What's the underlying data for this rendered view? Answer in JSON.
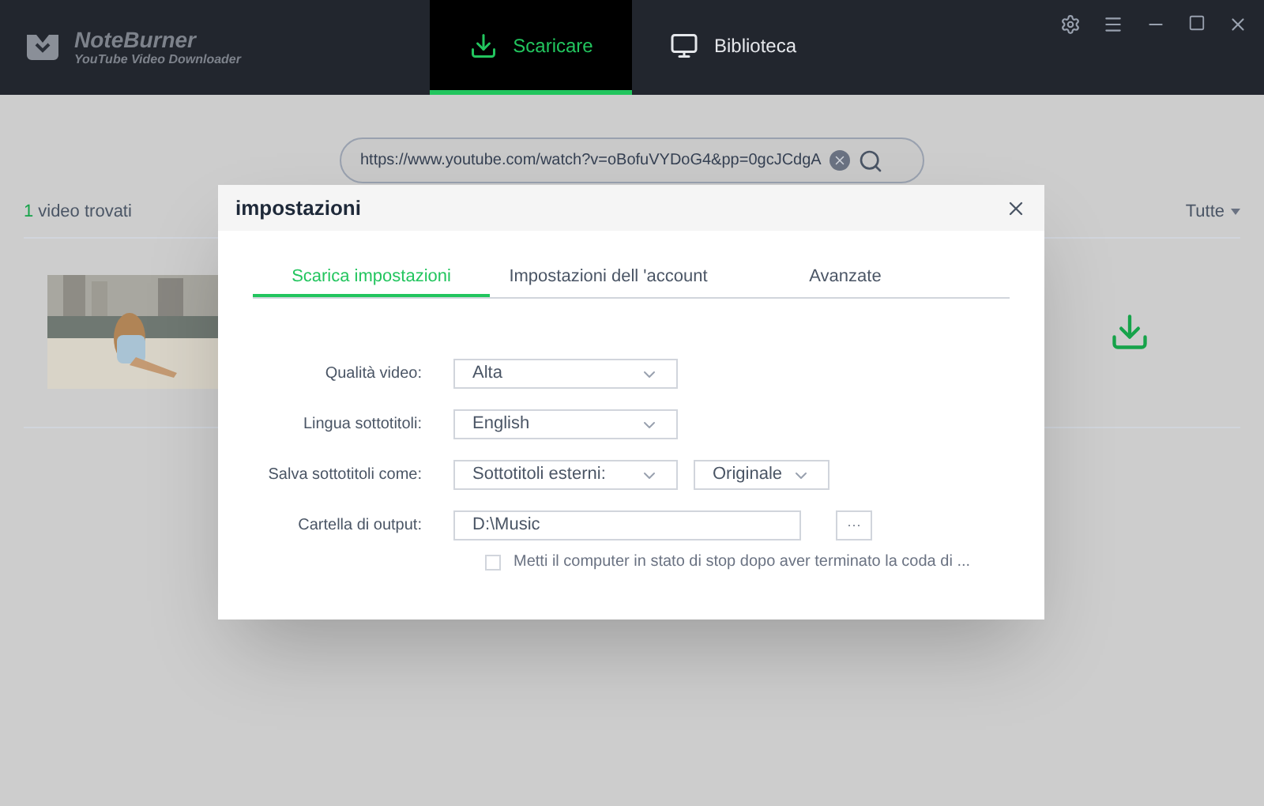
{
  "app": {
    "name": "NoteBurner",
    "subtitle": "YouTube Video Downloader"
  },
  "nav_tabs": [
    {
      "label": "Scaricare",
      "selected": true,
      "kind": "download"
    },
    {
      "label": "Biblioteca",
      "selected": false,
      "kind": "library"
    }
  ],
  "search": {
    "value": "https://www.youtube.com/watch?v=oBofuVYDoG4&pp=0gcJCdgA"
  },
  "results": {
    "count": "1",
    "label": "video trovati",
    "filter": "Tutte"
  },
  "dialog": {
    "title": "impostazioni",
    "tabs": [
      {
        "label": "Scarica impostazioni",
        "selected": true
      },
      {
        "label": "Impostazioni dell 'account",
        "selected": false
      },
      {
        "label": "Avanzate",
        "selected": false
      }
    ],
    "rows": [
      {
        "label": "Qualità video:",
        "controls": [
          {
            "kind": "select",
            "value": "Alta"
          }
        ]
      },
      {
        "label": "Lingua sottotitoli:",
        "controls": [
          {
            "kind": "select",
            "value": "English"
          }
        ]
      },
      {
        "label": "Salva sottotitoli come:",
        "controls": [
          {
            "kind": "select",
            "value": "Sottotitoli esterni:"
          },
          {
            "kind": "small-select",
            "value": "Originale"
          }
        ]
      },
      {
        "label": "Cartella di output:",
        "controls": [
          {
            "kind": "path",
            "value": "D:\\Music"
          },
          {
            "kind": "browse",
            "value": "···"
          }
        ]
      }
    ],
    "sleep_option": {
      "label": "Metti il computer in stato di stop dopo aver terminato la coda di ...",
      "checked": false
    }
  }
}
